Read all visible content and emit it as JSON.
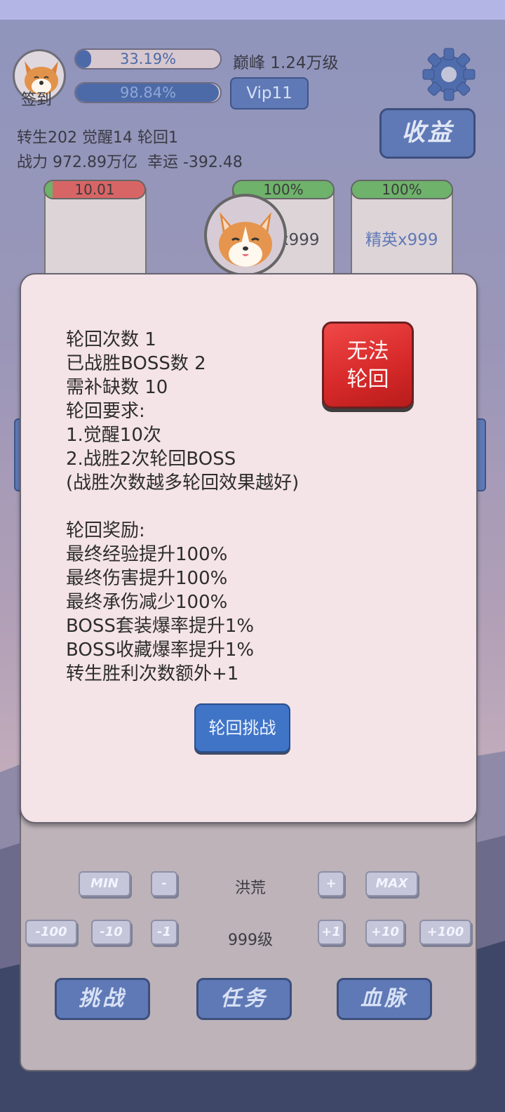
{
  "player": {
    "exp_percent_text": "33.19%",
    "exp_fraction": 0.3319,
    "hp_percent_text": "98.84%",
    "hp_fraction": 0.9884,
    "sign_in_label": "签到",
    "peak_level": "巅峰 1.24万级",
    "vip_label": "Vip11",
    "stats_line1": "转生202 觉醒14 轮回1",
    "stats_line2": "战力 972.89万亿  幸运 -392.48"
  },
  "header": {
    "income_label": "收益"
  },
  "cards": [
    {
      "bar_text": "10.01",
      "bar_fraction": 0.08,
      "bar_color": "#d86566",
      "label": ""
    },
    {
      "bar_text": "100%",
      "bar_fraction": 1.0,
      "bar_color": "#6eb26b",
      "label": "精英x999"
    },
    {
      "bar_text": "100%",
      "bar_fraction": 1.0,
      "bar_color": "#6eb26b",
      "label": "精英x999"
    }
  ],
  "controls": {
    "row1": {
      "min": "MIN",
      "minus": "-",
      "name": "洪荒",
      "plus": "+",
      "max": "MAX"
    },
    "row2": {
      "m100": "-100",
      "m10": "-10",
      "m1": "-1",
      "level": "999级",
      "p1": "+1",
      "p10": "+10",
      "p100": "+100"
    },
    "challenge": "挑战",
    "task": "任务",
    "bloodline": "血脉"
  },
  "modal": {
    "lines": [
      "轮回次数 1",
      "已战胜BOSS数 2",
      "需补缺数 10",
      "轮回要求:",
      "1.觉醒10次",
      "2.战胜2次轮回BOSS",
      "(战胜次数越多轮回效果越好)",
      "",
      "轮回奖励:",
      "最终经验提升100%",
      "最终伤害提升100%",
      "最终承伤减少100%",
      "BOSS套装爆率提升1%",
      "BOSS收藏爆率提升1%",
      "转生胜利次数额外+1"
    ],
    "status_line1": "无法",
    "status_line2": "轮回",
    "challenge_button": "轮回挑战"
  },
  "colors": {
    "accent_blue": "#5f79b6",
    "alert_red": "#e03a3a",
    "modal_bg": "#f4e3e7"
  }
}
